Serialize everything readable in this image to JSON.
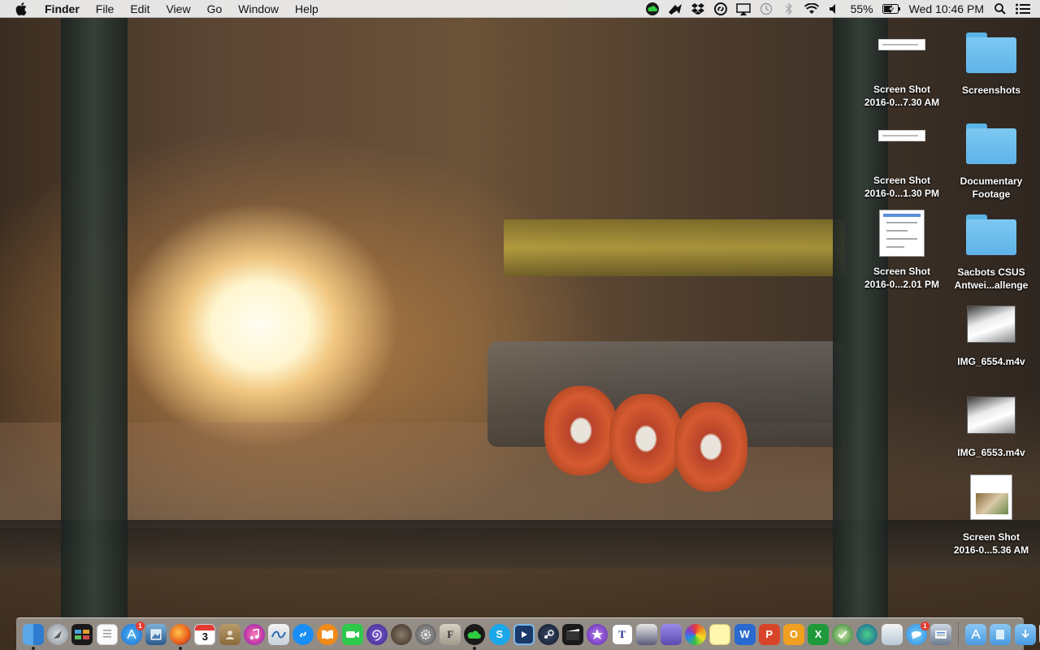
{
  "menubar": {
    "app_name": "Finder",
    "menus": [
      "File",
      "Edit",
      "View",
      "Go",
      "Window",
      "Help"
    ],
    "battery_percent": "55%",
    "clock": "Wed 10:46 PM"
  },
  "desktop": {
    "icons": [
      {
        "label1": "Screen Shot",
        "label2": "2016-0...7.30 AM",
        "kind": "screenshot-thin-icon"
      },
      {
        "label1": "Screenshots",
        "label2": "",
        "kind": "folder-icon"
      },
      {
        "label1": "Screen Shot",
        "label2": "2016-0...1.30 PM",
        "kind": "screenshot-thin-icon"
      },
      {
        "label1": "Documentary",
        "label2": "Footage",
        "kind": "folder-icon"
      },
      {
        "label1": "Screen Shot",
        "label2": "2016-0...2.01 PM",
        "kind": "screenshot-doc-icon"
      },
      {
        "label1": "Sacbots CSUS",
        "label2": "Antwei...allenge",
        "kind": "folder-icon"
      },
      {
        "label1": "IMG_6554.m4v",
        "label2": "",
        "kind": "video-icon"
      },
      {
        "label1": "IMG_6553.m4v",
        "label2": "",
        "kind": "video-icon"
      },
      {
        "label1": "Screen Shot",
        "label2": "2016-0...5.36 AM",
        "kind": "screenshot-photo-icon"
      }
    ]
  },
  "dock": {
    "app_store_badge": "1",
    "calendar_day": "3",
    "messages_badge": "1",
    "font_app_letter": "F",
    "skype_letter": "S",
    "textwrangler_letter": "T",
    "word_letter": "W",
    "powerpoint_letter": "P",
    "outlook_letter": "O",
    "excel_letter": "X"
  },
  "colors": {
    "menubar_bg": "#ececec",
    "folder_blue": "#5fb3e8",
    "badge_red": "#e53a30"
  }
}
